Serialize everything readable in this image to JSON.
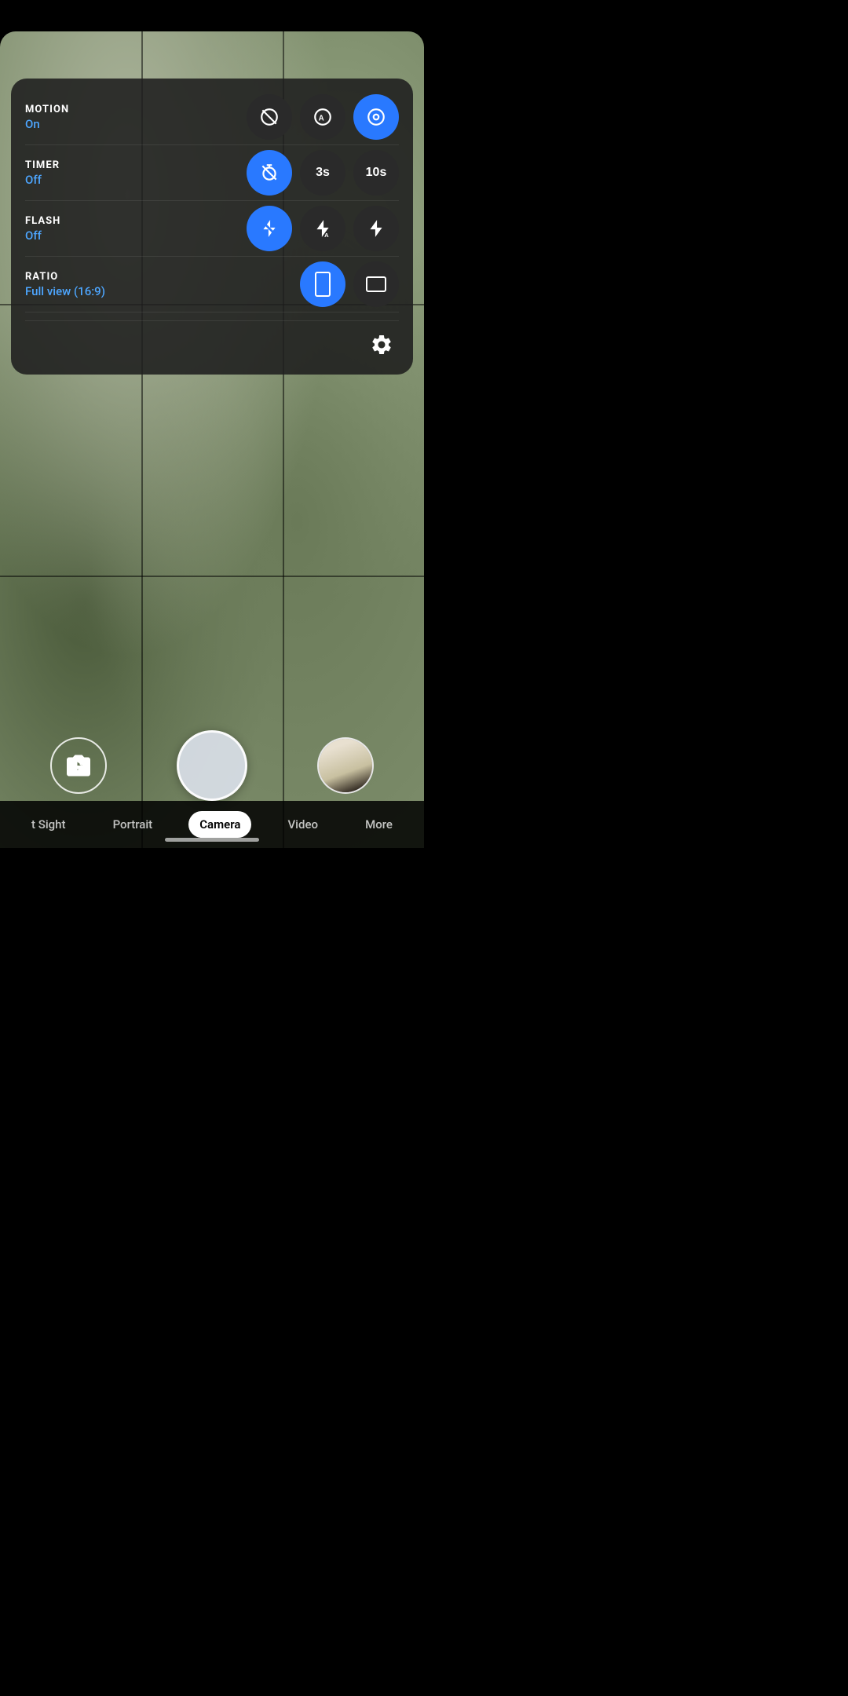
{
  "app": {
    "title": "Camera"
  },
  "settings_panel": {
    "motion": {
      "name": "MOTION",
      "value": "On",
      "options": [
        {
          "id": "motion-off",
          "type": "icon",
          "icon": "motion-off",
          "active": false
        },
        {
          "id": "motion-auto",
          "type": "icon",
          "icon": "motion-auto",
          "active": false
        },
        {
          "id": "motion-on",
          "type": "icon",
          "icon": "motion-on",
          "active": true
        }
      ]
    },
    "timer": {
      "name": "TIMER",
      "value": "Off",
      "options": [
        {
          "id": "timer-off",
          "type": "icon",
          "icon": "timer-off",
          "active": true
        },
        {
          "id": "timer-3s",
          "type": "text",
          "label": "3s",
          "active": false
        },
        {
          "id": "timer-10s",
          "type": "text",
          "label": "10s",
          "active": false
        }
      ]
    },
    "flash": {
      "name": "FLASH",
      "value": "Off",
      "options": [
        {
          "id": "flash-off",
          "type": "icon",
          "icon": "flash-off",
          "active": true
        },
        {
          "id": "flash-auto",
          "type": "icon",
          "icon": "flash-auto",
          "active": false
        },
        {
          "id": "flash-on",
          "type": "icon",
          "icon": "flash-on",
          "active": false
        }
      ]
    },
    "ratio": {
      "name": "RATIO",
      "value": "Full view (16:9)",
      "options": [
        {
          "id": "ratio-169",
          "type": "shape",
          "shape": "tall",
          "active": true
        },
        {
          "id": "ratio-43",
          "type": "shape",
          "shape": "wide",
          "active": false
        }
      ]
    }
  },
  "mode_tabs": [
    {
      "id": "night-sight",
      "label": "t Sight",
      "active": false
    },
    {
      "id": "portrait",
      "label": "Portrait",
      "active": false
    },
    {
      "id": "camera",
      "label": "Camera",
      "active": true
    },
    {
      "id": "video",
      "label": "Video",
      "active": false
    },
    {
      "id": "more",
      "label": "More",
      "active": false
    }
  ],
  "colors": {
    "active_blue": "#2979ff",
    "text_blue": "#4da6ff",
    "dark_btn": "#2a2a2a"
  }
}
